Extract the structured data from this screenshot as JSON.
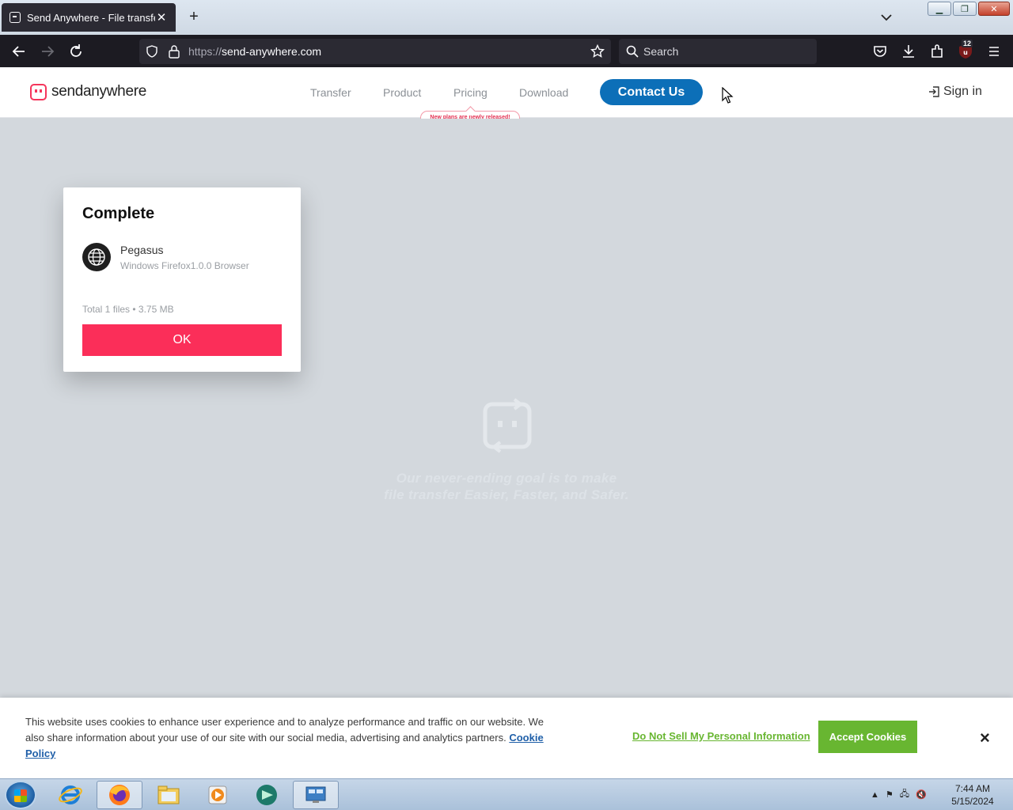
{
  "browser": {
    "tab_title": "Send Anywhere - File transfer",
    "url_protocol": "https://",
    "url_host": "send-anywhere.com",
    "search_placeholder": "Search",
    "extension_badge": "12"
  },
  "header": {
    "logo_text_bold": "send",
    "logo_text_rest": "anywhere",
    "nav": [
      "Transfer",
      "Product",
      "Pricing",
      "Download"
    ],
    "contact_label": "Contact Us",
    "signin_label": "Sign in",
    "pricing_tooltip": "New plans are newly released!"
  },
  "dialog": {
    "title": "Complete",
    "device_name": "Pegasus",
    "device_sub": "Windows Firefox1.0.0 Browser",
    "total": "Total 1 files • 3.75 MB",
    "ok_label": "OK"
  },
  "background": {
    "tagline_line1": "Our never-ending goal is to make",
    "tagline_line2": "file transfer Easier, Faster, and Safer."
  },
  "cookie": {
    "text": "This website uses cookies to enhance user experience and to analyze performance and traffic on our website. We also share information about your use of our site with our social media, advertising and analytics partners.",
    "policy_link": "Cookie Policy",
    "do_not_sell": "Do Not Sell My Personal Information",
    "accept": "Accept Cookies",
    "close": "×"
  },
  "taskbar": {
    "time": "7:44 AM",
    "date": "5/15/2024"
  },
  "colors": {
    "brand_red": "#fb2e59",
    "contact_blue": "#0c6fb8",
    "cookie_green": "#68b631"
  }
}
